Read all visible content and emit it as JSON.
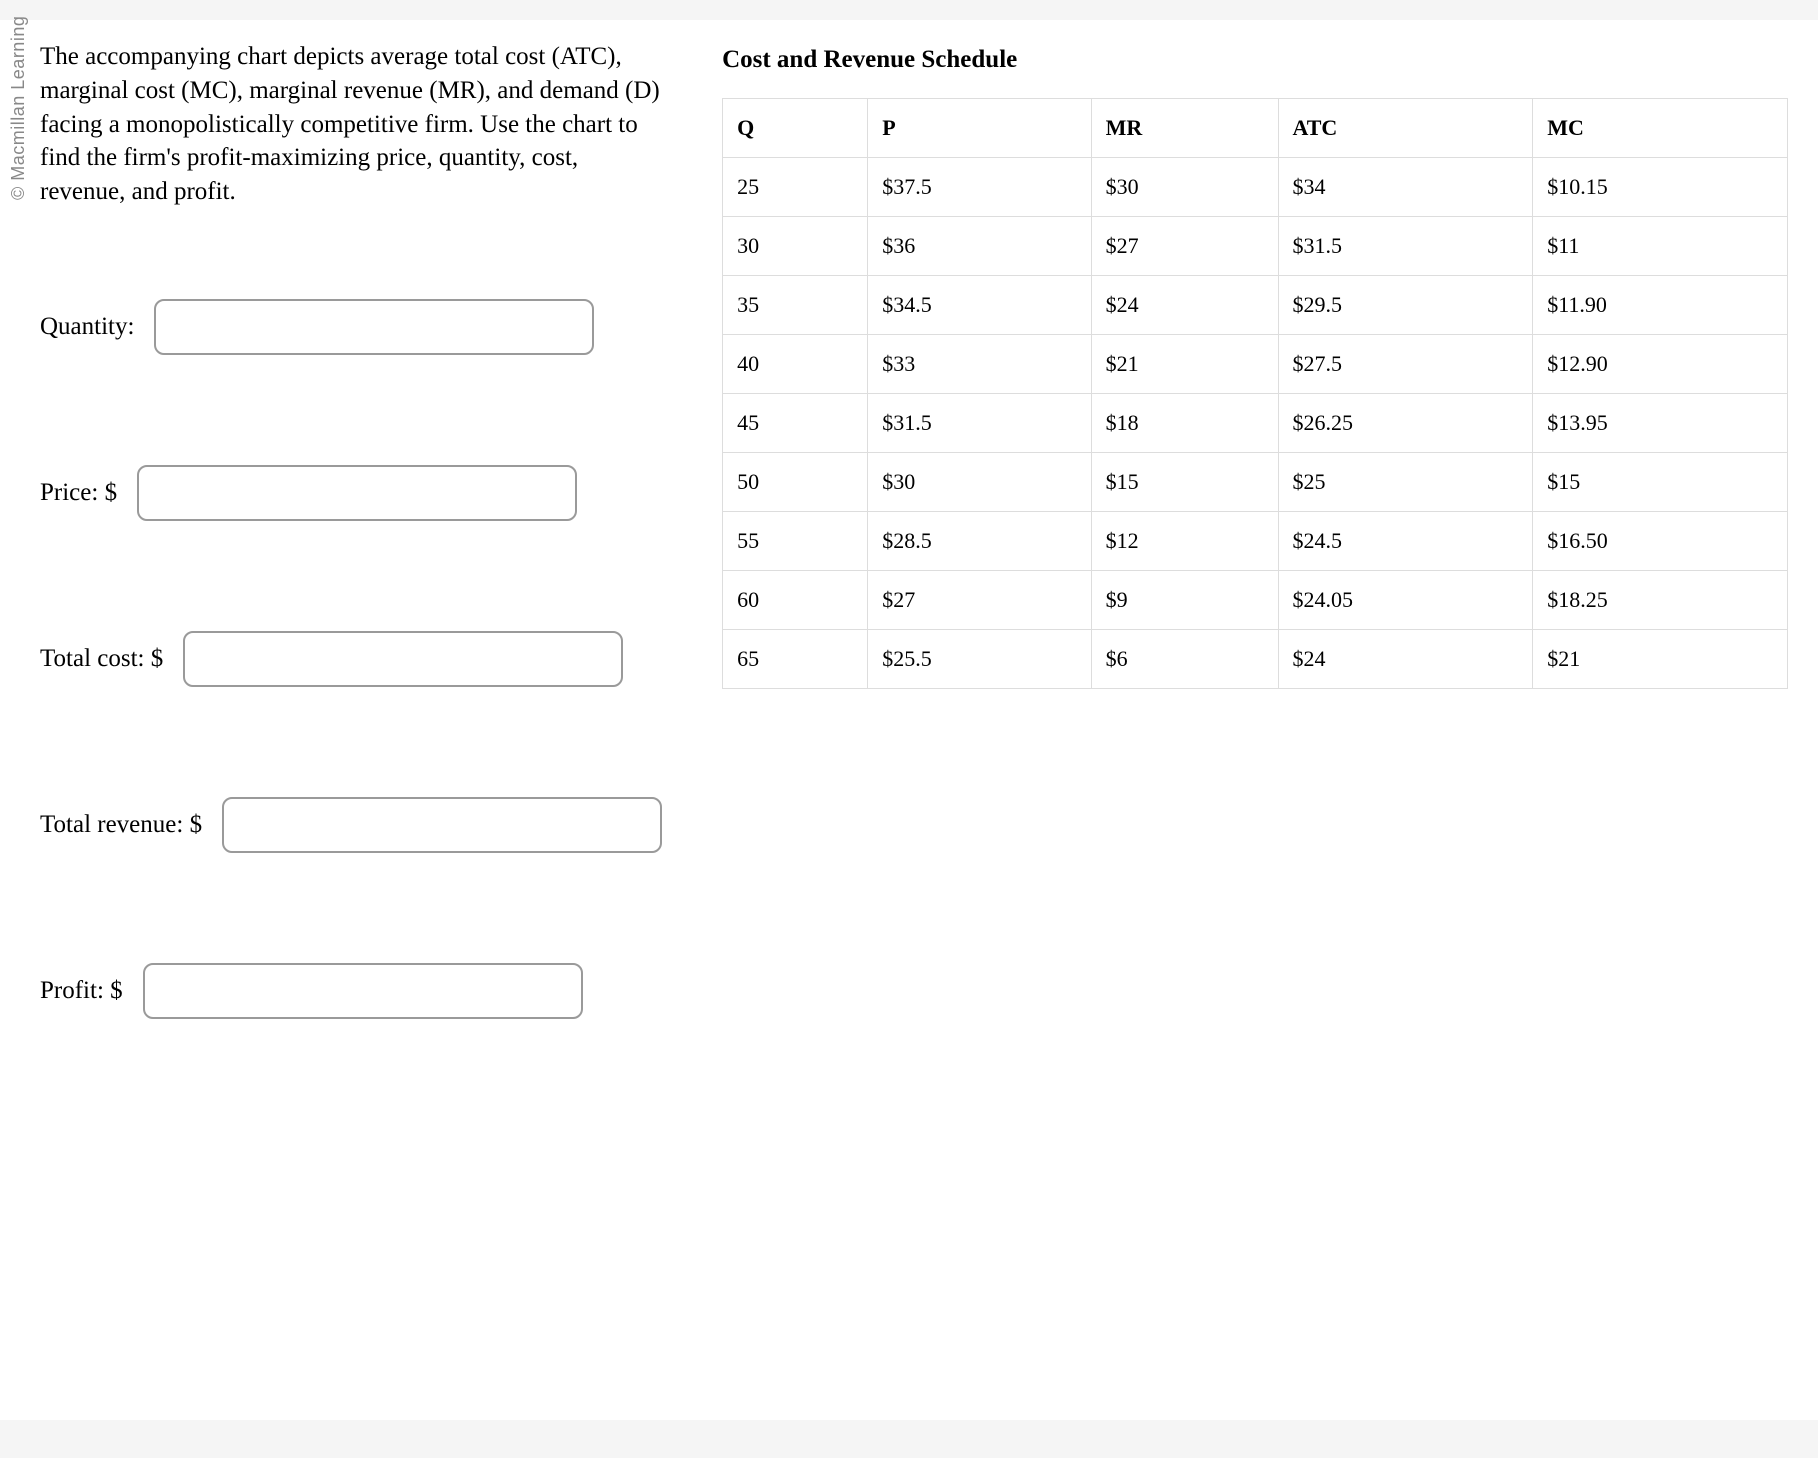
{
  "brand": "© Macmillan Learning",
  "prompt": "The accompanying chart depicts average total cost (ATC), marginal cost (MC), marginal revenue (MR), and demand (D) facing a monopolistically competitive firm. Use the chart to find the firm's profit-maximizing price, quantity, cost, revenue, and profit.",
  "answers": {
    "quantity": {
      "label": "Quantity:",
      "value": ""
    },
    "price": {
      "label": "Price: $",
      "value": ""
    },
    "total_cost": {
      "label": "Total cost: $",
      "value": ""
    },
    "total_revenue": {
      "label": "Total revenue: $",
      "value": ""
    },
    "profit": {
      "label": "Profit: $",
      "value": ""
    }
  },
  "table": {
    "title": "Cost and Revenue Schedule",
    "headers": [
      "Q",
      "P",
      "MR",
      "ATC",
      "MC"
    ],
    "rows": [
      [
        "25",
        "$37.5",
        "$30",
        "$34",
        "$10.15"
      ],
      [
        "30",
        "$36",
        "$27",
        "$31.5",
        "$11"
      ],
      [
        "35",
        "$34.5",
        "$24",
        "$29.5",
        "$11.90"
      ],
      [
        "40",
        "$33",
        "$21",
        "$27.5",
        "$12.90"
      ],
      [
        "45",
        "$31.5",
        "$18",
        "$26.25",
        "$13.95"
      ],
      [
        "50",
        "$30",
        "$15",
        "$25",
        "$15"
      ],
      [
        "55",
        "$28.5",
        "$12",
        "$24.5",
        "$16.50"
      ],
      [
        "60",
        "$27",
        "$9",
        "$24.05",
        "$18.25"
      ],
      [
        "65",
        "$25.5",
        "$6",
        "$24",
        "$21"
      ]
    ]
  },
  "chart_data": {
    "type": "table",
    "title": "Cost and Revenue Schedule",
    "columns": [
      "Q",
      "P",
      "MR",
      "ATC",
      "MC"
    ],
    "data": [
      {
        "Q": 25,
        "P": 37.5,
        "MR": 30,
        "ATC": 34,
        "MC": 10.15
      },
      {
        "Q": 30,
        "P": 36,
        "MR": 27,
        "ATC": 31.5,
        "MC": 11
      },
      {
        "Q": 35,
        "P": 34.5,
        "MR": 24,
        "ATC": 29.5,
        "MC": 11.9
      },
      {
        "Q": 40,
        "P": 33,
        "MR": 21,
        "ATC": 27.5,
        "MC": 12.9
      },
      {
        "Q": 45,
        "P": 31.5,
        "MR": 18,
        "ATC": 26.25,
        "MC": 13.95
      },
      {
        "Q": 50,
        "P": 30,
        "MR": 15,
        "ATC": 25,
        "MC": 15
      },
      {
        "Q": 55,
        "P": 28.5,
        "MR": 12,
        "ATC": 24.5,
        "MC": 16.5
      },
      {
        "Q": 60,
        "P": 27,
        "MR": 9,
        "ATC": 24.05,
        "MC": 18.25
      },
      {
        "Q": 65,
        "P": 25.5,
        "MR": 6,
        "ATC": 24,
        "MC": 21
      }
    ]
  }
}
